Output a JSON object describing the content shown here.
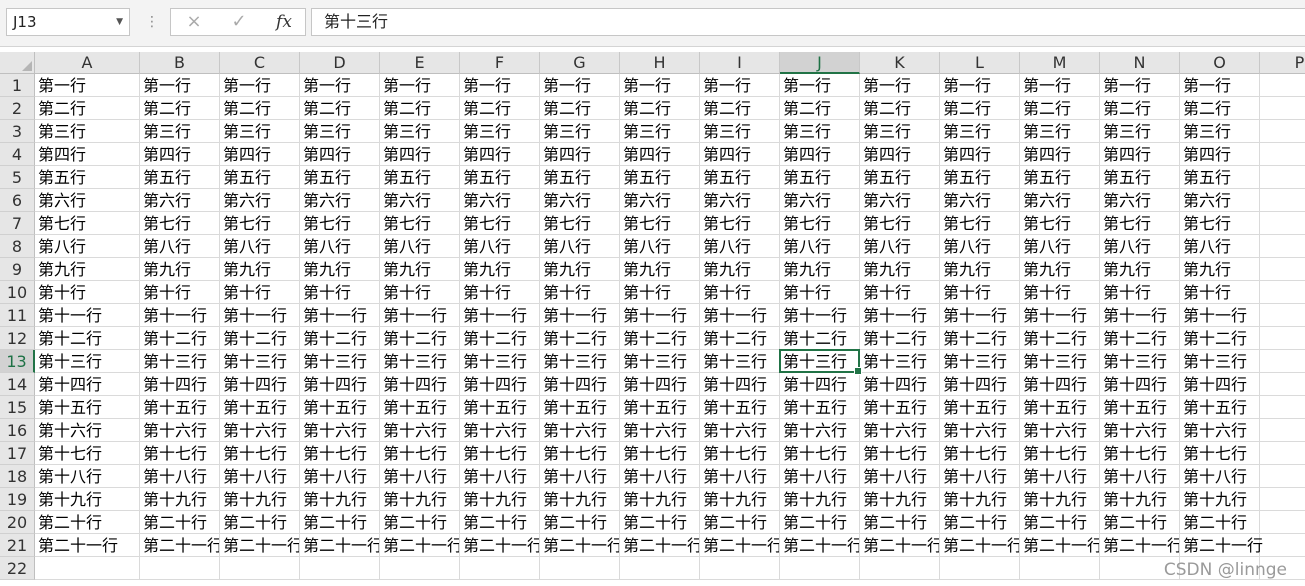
{
  "formula_bar": {
    "name_box": "J13",
    "formula": "第十三行",
    "cancel_icon": "×",
    "enter_icon": "✓",
    "fx_label": "fx"
  },
  "columns": [
    "A",
    "B",
    "C",
    "D",
    "E",
    "F",
    "G",
    "H",
    "I",
    "J",
    "K",
    "L",
    "M",
    "N",
    "O",
    "P"
  ],
  "rows": [
    "1",
    "2",
    "3",
    "4",
    "5",
    "6",
    "7",
    "8",
    "9",
    "10",
    "11",
    "12",
    "13",
    "14",
    "15",
    "16",
    "17",
    "18",
    "19",
    "20",
    "21",
    "22"
  ],
  "row_text": [
    "第一行",
    "第二行",
    "第三行",
    "第四行",
    "第五行",
    "第六行",
    "第七行",
    "第八行",
    "第九行",
    "第十行",
    "第十一行",
    "第十二行",
    "第十三行",
    "第十四行",
    "第十五行",
    "第十六行",
    "第十七行",
    "第十八行",
    "第十九行",
    "第二十行",
    "第二十一行"
  ],
  "filled_columns": 15,
  "selected_cell": {
    "column": "J",
    "row": "13"
  },
  "colors": {
    "selection": "#217346",
    "header_bg": "#e6e6e6"
  },
  "watermark": "CSDN @linnge"
}
